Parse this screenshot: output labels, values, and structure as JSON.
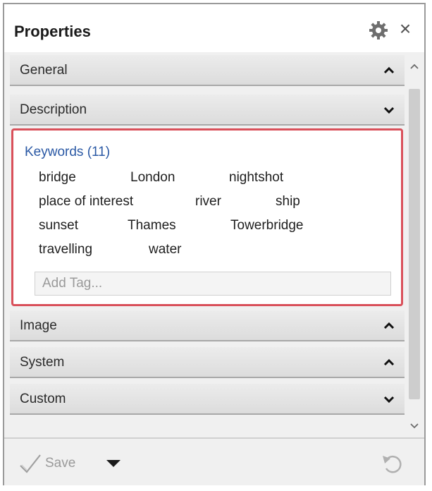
{
  "panel": {
    "title": "Properties",
    "gear_icon": "gear-icon",
    "close_label": "×"
  },
  "sections": {
    "general": {
      "label": "General",
      "state": "collapsed-up"
    },
    "description": {
      "label": "Description",
      "state": "expanded"
    },
    "image": {
      "label": "Image",
      "state": "collapsed-up"
    },
    "system": {
      "label": "System",
      "state": "collapsed-up"
    },
    "custom": {
      "label": "Custom",
      "state": "expanded"
    }
  },
  "keywords": {
    "header": "Keywords (11)",
    "rows": [
      [
        "bridge",
        "London",
        "nightshot"
      ],
      [
        "place of interest",
        "river",
        "ship"
      ],
      [
        "sunset",
        "Thames",
        "Towerbridge"
      ],
      [
        "travelling",
        "water"
      ]
    ],
    "add_placeholder": "Add Tag..."
  },
  "footer": {
    "save_label": "Save",
    "undo_icon": "undo-icon"
  },
  "colors": {
    "highlight_border": "#d9505a",
    "keyword_header": "#2b59a5"
  }
}
